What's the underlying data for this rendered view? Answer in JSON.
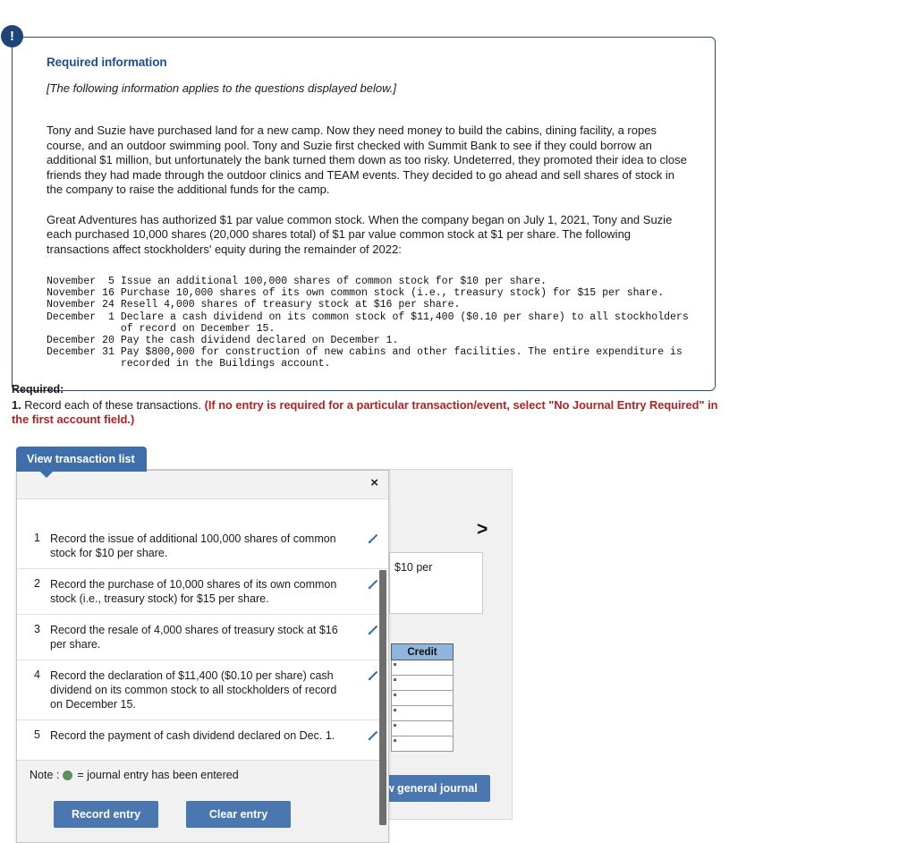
{
  "alert_icon": "exclamation-icon",
  "required_info": {
    "title": "Required information",
    "bracket_note": "[The following information applies to the questions displayed below.]",
    "paragraph1": "Tony and Suzie have purchased land for a new camp. Now they need money to build the cabins, dining facility, a ropes course, and an outdoor swimming pool. Tony and Suzie first checked with Summit Bank to see if they could borrow an additional $1 million, but unfortunately the bank turned them down as too risky. Undeterred, they promoted their idea to close friends they had made through the outdoor clinics and TEAM events. They decided to go ahead and sell shares of stock in the company to raise the additional funds for the camp.",
    "paragraph2": "Great Adventures has authorized $1 par value common stock. When the company began on July 1, 2021, Tony and Suzie each purchased 10,000 shares (20,000 shares total) of $1 par value common stock at $1 per share. The following transactions affect stockholders' equity during the remainder of 2022:",
    "transactions_text": "November  5 Issue an additional 100,000 shares of common stock for $10 per share.\nNovember 16 Purchase 10,000 shares of its own common stock (i.e., treasury stock) for $15 per share.\nNovember 24 Resell 4,000 shares of treasury stock at $16 per share.\nDecember  1 Declare a cash dividend on its common stock of $11,400 ($0.10 per share) to all stockholders\n            of record on December 15.\nDecember 20 Pay the cash dividend declared on December 1.\nDecember 31 Pay $800,000 for construction of new cabins and other facilities. The entire expenditure is\n            recorded in the Buildings account."
  },
  "required_section": {
    "label": "Required:",
    "number": "1.",
    "text": " Record each of these transactions. ",
    "red_text": "(If no entry is required for a particular transaction/event, select \"No Journal Entry Required\" in the first account field.)"
  },
  "tab": {
    "label": "View transaction list"
  },
  "worksheet": {
    "next_icon": ">",
    "white_box_text": "$10 per",
    "credit_header": "Credit",
    "credit_rows": [
      "",
      "",
      "",
      "",
      "",
      ""
    ],
    "view_journal_label": "View general journal"
  },
  "modal": {
    "close_icon": "×",
    "transactions": [
      {
        "num": "1",
        "text": "Record the issue of additional 100,000 shares of common stock for $10 per share."
      },
      {
        "num": "2",
        "text": "Record the purchase of 10,000 shares of its own common stock (i.e., treasury stock) for $15 per share."
      },
      {
        "num": "3",
        "text": "Record the resale of 4,000 shares of treasury stock at $16 per share."
      },
      {
        "num": "4",
        "text": "Record the declaration of $11,400 ($0.10 per share) cash dividend on its common stock to all stockholders of record on December 15."
      },
      {
        "num": "5",
        "text": "Record the payment of cash dividend declared on Dec. 1."
      }
    ],
    "note_prefix": "Note :",
    "note_suffix": "= journal entry has been entered",
    "record_entry_label": "Record entry",
    "clear_entry_label": "Clear entry"
  },
  "colors": {
    "accent_blue": "#4a77b0",
    "heading_blue": "#1f4e96",
    "warning_red": "#b22222",
    "green_dot": "#5e8f5c",
    "panel_border": "#2e4a7d"
  }
}
